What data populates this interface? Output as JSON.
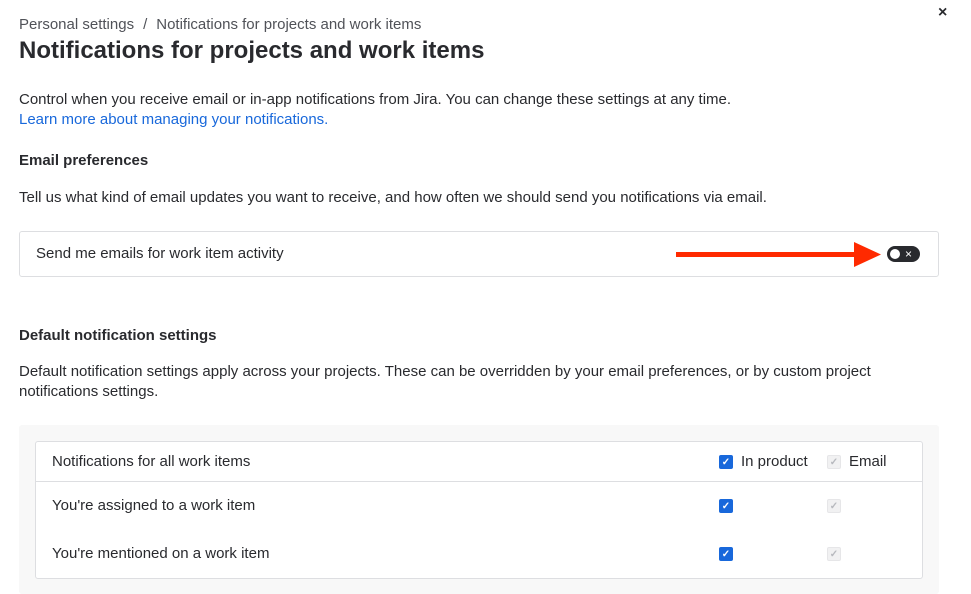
{
  "breadcrumb": {
    "items": [
      "Personal settings",
      "Notifications for projects and work items"
    ],
    "separator": "/"
  },
  "title": "Notifications for projects and work items",
  "close_icon": "×",
  "intro": {
    "text": "Control when you receive email or in-app notifications from Jira. You can change these settings at any time.",
    "link": "Learn more about managing your notifications."
  },
  "email": {
    "heading": "Email preferences",
    "description": "Tell us what kind of email updates you want to receive, and how often we should send you notifications via email.",
    "toggle_label": "Send me emails for work item activity",
    "toggle_on": false,
    "toggle_icon": "×"
  },
  "defaults": {
    "heading": "Default notification settings",
    "description": "Default notification settings apply across your projects. These can be overridden by your email preferences, or by custom project notifications settings.",
    "table": {
      "header": "Notifications for all work items",
      "columns": [
        "In product",
        "Email"
      ],
      "rows": [
        {
          "label": "You're assigned to a work item",
          "in_product": true,
          "email": true
        },
        {
          "label": "You're mentioned on a work item",
          "in_product": true,
          "email": true
        }
      ]
    }
  },
  "check": "✓",
  "colors": {
    "accent": "#1868db",
    "arrow": "#ff2a00"
  }
}
